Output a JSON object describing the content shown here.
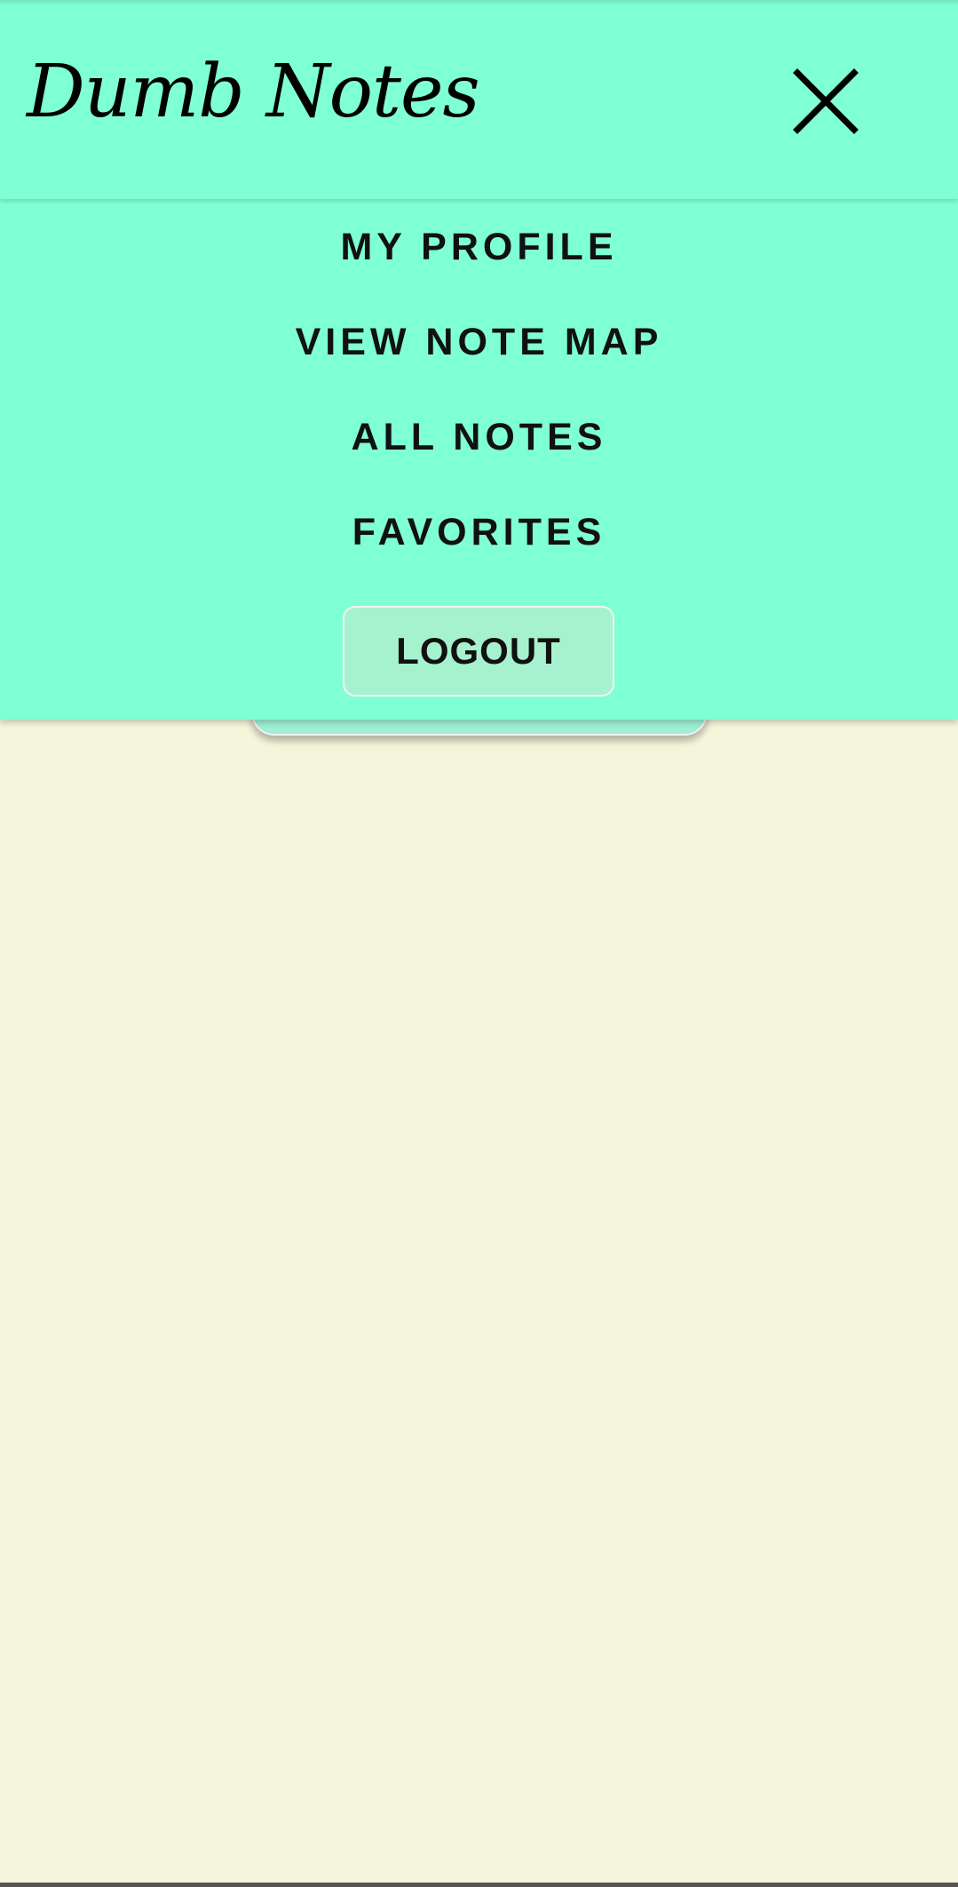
{
  "header": {
    "app_title": "Dumb Notes",
    "close_icon": "close-icon"
  },
  "menu": {
    "items": [
      {
        "label": "MY PROFILE"
      },
      {
        "label": "VIEW NOTE MAP"
      },
      {
        "label": "ALL NOTES"
      },
      {
        "label": "FAVORITES"
      }
    ],
    "logout_label": "LOGOUT"
  },
  "colors": {
    "header_background": "#7FFFD4",
    "menu_background": "#7FFFD4",
    "logout_button_background": "#A6F2CF",
    "page_background": "#F5F5DC",
    "text": "#111111"
  }
}
